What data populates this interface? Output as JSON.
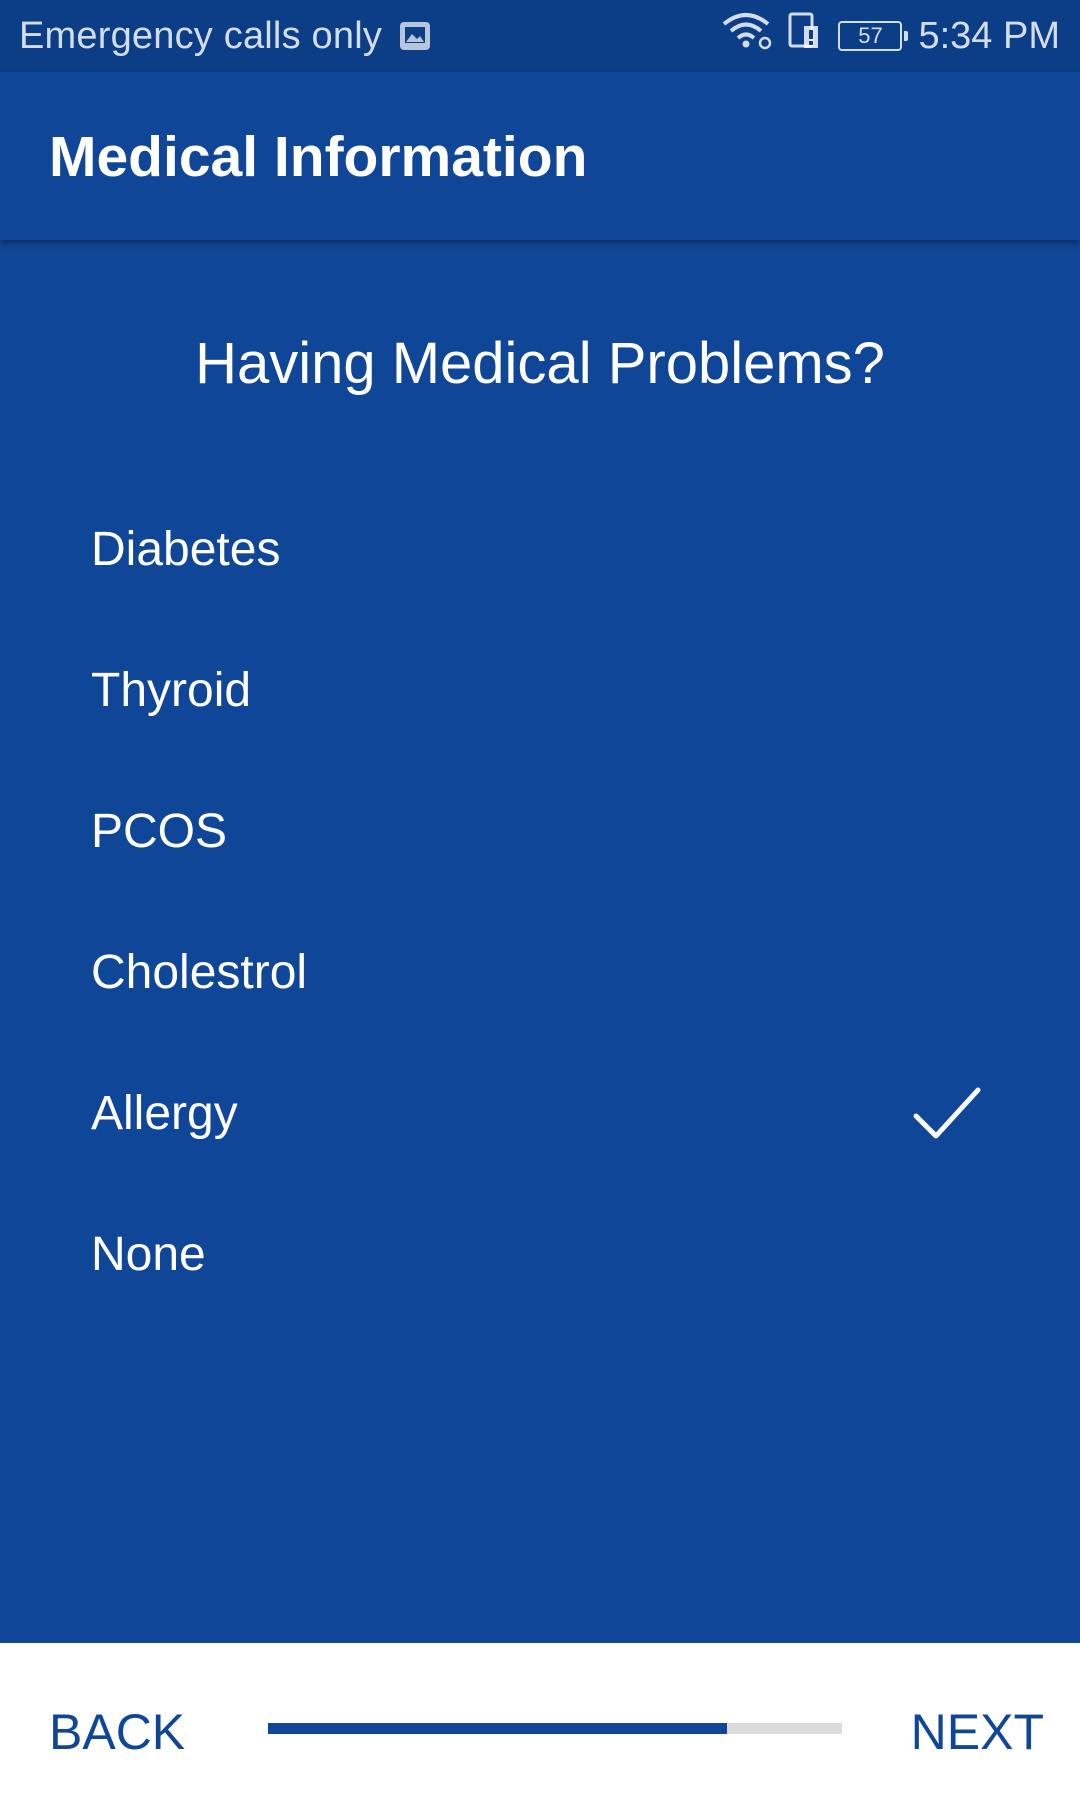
{
  "status_bar": {
    "carrier_text": "Emergency calls only",
    "battery_level": "57",
    "time": "5:34 PM",
    "icons": [
      "image-notification-icon",
      "wifi-icon",
      "sim-icon",
      "battery-icon"
    ]
  },
  "app_bar": {
    "title": "Medical Information"
  },
  "question": "Having Medical Problems?",
  "options": [
    {
      "label": "Diabetes",
      "checked": false
    },
    {
      "label": "Thyroid",
      "checked": false
    },
    {
      "label": "PCOS",
      "checked": false
    },
    {
      "label": "Cholestrol",
      "checked": false
    },
    {
      "label": "Allergy",
      "checked": true
    },
    {
      "label": "None",
      "checked": false
    }
  ],
  "footer": {
    "back_label": "BACK",
    "next_label": "NEXT",
    "progress_fraction": 0.8
  },
  "colors": {
    "primary": "#0f4697",
    "status_bar": "#0c3d87",
    "progress_track": "#dcdcdc",
    "footer_background": "#ffffff"
  }
}
